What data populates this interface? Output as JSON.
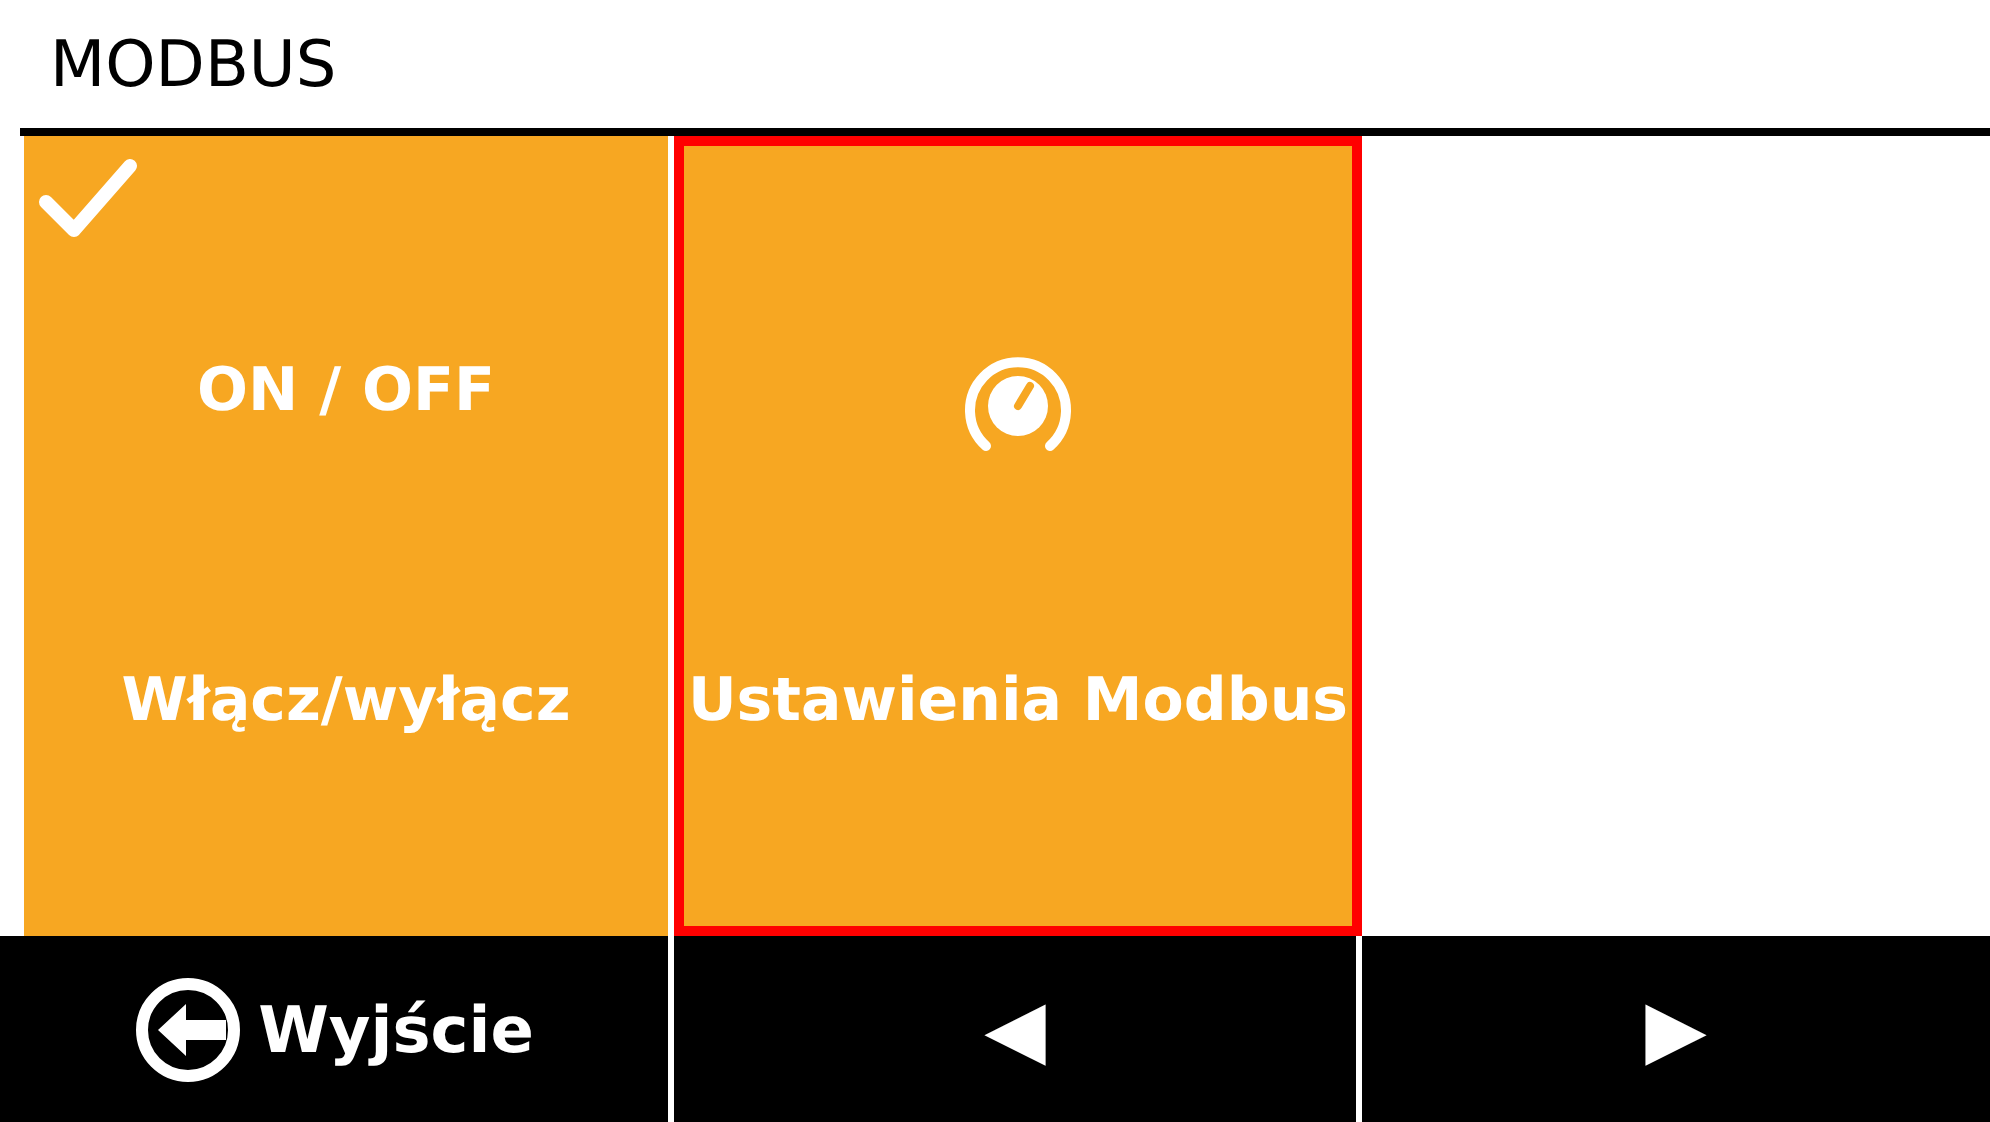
{
  "title": "MODBUS",
  "tiles": [
    {
      "kind": "toggle",
      "checked": true,
      "selected": false,
      "value": "ON / OFF",
      "label": "Włącz/wyłącz"
    },
    {
      "kind": "settings",
      "selected": true,
      "label": "Ustawienia Modbus"
    }
  ],
  "footer": [
    {
      "kind": "exit",
      "label": "Wyjście"
    },
    {
      "kind": "nav",
      "label": "◀"
    },
    {
      "kind": "nav",
      "label": "▶"
    }
  ]
}
